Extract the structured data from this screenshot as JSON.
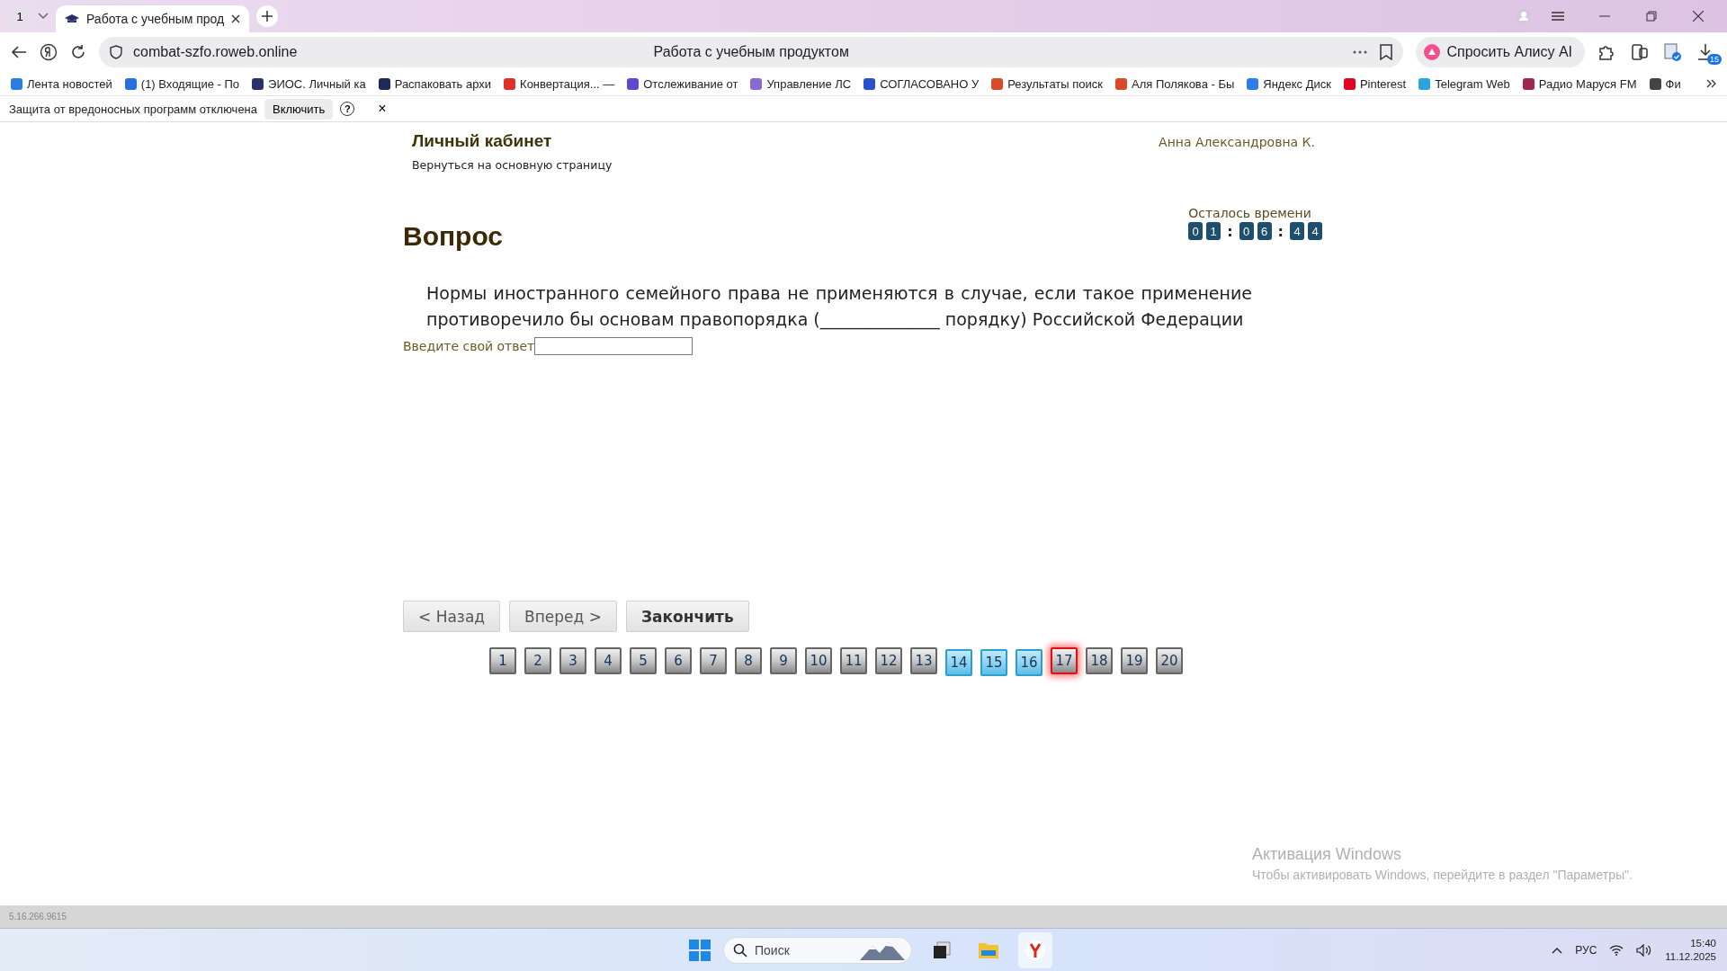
{
  "browser": {
    "tab_count": "1",
    "tabs": [
      {
        "title": "Работа с учебным прод",
        "selected": true
      }
    ],
    "address": "combat-szfo.roweb.online",
    "page_title": "Работа с учебным продуктом",
    "alice_button": "Спросить Алису AI",
    "downloads_badge": "15",
    "bookmarks": [
      {
        "label": "Лента новостей",
        "color": "#2a7de1"
      },
      {
        "label": "(1) Входящие - По",
        "color": "#2a6fe0"
      },
      {
        "label": "ЭИОС. Личный ка",
        "color": "#2c2f6e"
      },
      {
        "label": "Распаковать архи",
        "color": "#1b2a5a"
      },
      {
        "label": "Конвертация... —",
        "color": "#e0302a"
      },
      {
        "label": "Отслеживание от",
        "color": "#5b4bd0"
      },
      {
        "label": "Управление ЛС",
        "color": "#8a6ad0"
      },
      {
        "label": "СОГЛАСОВАНО У",
        "color": "#2a52c8"
      },
      {
        "label": "Результаты поиск",
        "color": "#d84a2a"
      },
      {
        "label": "Аля Полякова - Бы",
        "color": "#d84a2a"
      },
      {
        "label": "Яндекс Диск",
        "color": "#2f7de8"
      },
      {
        "label": "Pinterest",
        "color": "#e60023"
      },
      {
        "label": "Telegram Web",
        "color": "#2aa3e0"
      },
      {
        "label": "Радио Маруся FM",
        "color": "#a0284a"
      },
      {
        "label": "Фи",
        "color": "#444444"
      }
    ],
    "infobar": {
      "text": "Защита от вредоносных программ отключена",
      "button": "Включить",
      "help": "?",
      "close": "×"
    }
  },
  "page": {
    "cabinet_title": "Личный кабинет",
    "back_link": "Вернуться на основную страницу",
    "user": "Анна Александровна К.",
    "timer": {
      "label": "Осталось времени",
      "parts": [
        {
          "kind": "digit",
          "text": "0"
        },
        {
          "kind": "digit",
          "text": "1"
        },
        {
          "kind": "sep",
          "text": ":"
        },
        {
          "kind": "digit",
          "text": "0"
        },
        {
          "kind": "digit",
          "text": "6"
        },
        {
          "kind": "sep",
          "text": ":"
        },
        {
          "kind": "digit",
          "text": "4"
        },
        {
          "kind": "digit",
          "text": "4"
        }
      ]
    },
    "heading": "Вопрос",
    "question": "Нормы иностранного семейного права не применяются в случае, если такое применение противоречило бы основам правопорядка (______________ порядку) Российской Федерации",
    "answer_label": "Введите свой ответ",
    "nav_buttons": [
      {
        "label": "< Назад",
        "kind": "normal"
      },
      {
        "label": "Вперед >",
        "kind": "normal"
      },
      {
        "label": "Закончить",
        "kind": "primary"
      }
    ],
    "pages": [
      {
        "label": "1",
        "answered": false,
        "selected": false
      },
      {
        "label": "2",
        "answered": false,
        "selected": false
      },
      {
        "label": "3",
        "answered": false,
        "selected": false
      },
      {
        "label": "4",
        "answered": false,
        "selected": false
      },
      {
        "label": "5",
        "answered": false,
        "selected": false
      },
      {
        "label": "6",
        "answered": false,
        "selected": false
      },
      {
        "label": "7",
        "answered": false,
        "selected": false
      },
      {
        "label": "8",
        "answered": false,
        "selected": false
      },
      {
        "label": "9",
        "answered": false,
        "selected": false
      },
      {
        "label": "10",
        "answered": false,
        "selected": false
      },
      {
        "label": "11",
        "answered": false,
        "selected": false
      },
      {
        "label": "12",
        "answered": false,
        "selected": false
      },
      {
        "label": "13",
        "answered": false,
        "selected": false
      },
      {
        "label": "14",
        "answered": true,
        "selected": false
      },
      {
        "label": "15",
        "answered": true,
        "selected": false
      },
      {
        "label": "16",
        "answered": true,
        "selected": false
      },
      {
        "label": "17",
        "answered": false,
        "selected": true
      },
      {
        "label": "18",
        "answered": false,
        "selected": false
      },
      {
        "label": "19",
        "answered": false,
        "selected": false
      },
      {
        "label": "20",
        "answered": false,
        "selected": false
      }
    ],
    "activation": {
      "title": "Активация Windows",
      "text": "Чтобы активировать Windows, перейдите в раздел \"Параметры\"."
    },
    "version": "5.16.266.9615"
  },
  "taskbar": {
    "search_placeholder": "Поиск",
    "language": "РУС",
    "time": "15:40",
    "date": "11.12.2025"
  }
}
